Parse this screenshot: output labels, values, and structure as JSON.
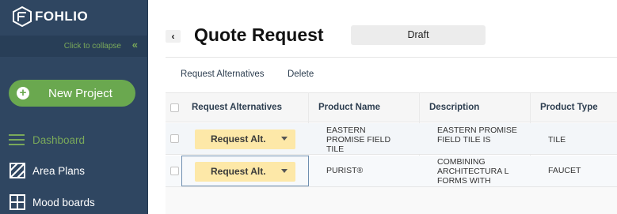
{
  "app": {
    "logo_text": "FOHLIO",
    "collapse_text": "Click to collapse",
    "collapse_icon": "«"
  },
  "sidebar": {
    "new_project_label": "New Project",
    "items": [
      {
        "label": "Dashboard",
        "icon": "dashboard-icon",
        "active": true
      },
      {
        "label": "Area Plans",
        "icon": "area-plans-icon",
        "active": false
      },
      {
        "label": "Mood boards",
        "icon": "mood-boards-icon",
        "active": false
      }
    ]
  },
  "header": {
    "back_label": "‹",
    "title": "Quote Request",
    "status": "Draft"
  },
  "toolbar": {
    "request_alternatives": "Request Alternatives",
    "delete": "Delete"
  },
  "table": {
    "columns": [
      "Request Alternatives",
      "Product Name",
      "Description",
      "Product Type"
    ],
    "rows": [
      {
        "action_label": "Request Alt.",
        "product_name": "EASTERN PROMISE FIELD TILE",
        "description": "EASTERN PROMISE FIELD TILE IS",
        "product_type": "TILE"
      },
      {
        "action_label": "Request Alt.",
        "product_name": "PURIST®",
        "description": "COMBINING ARCHITECTURA L FORMS WITH",
        "product_type": "FAUCET"
      }
    ]
  },
  "colors": {
    "sidebar_bg": "#2f4661",
    "accent_green": "#6aa84f",
    "request_button": "#fde8a8"
  }
}
